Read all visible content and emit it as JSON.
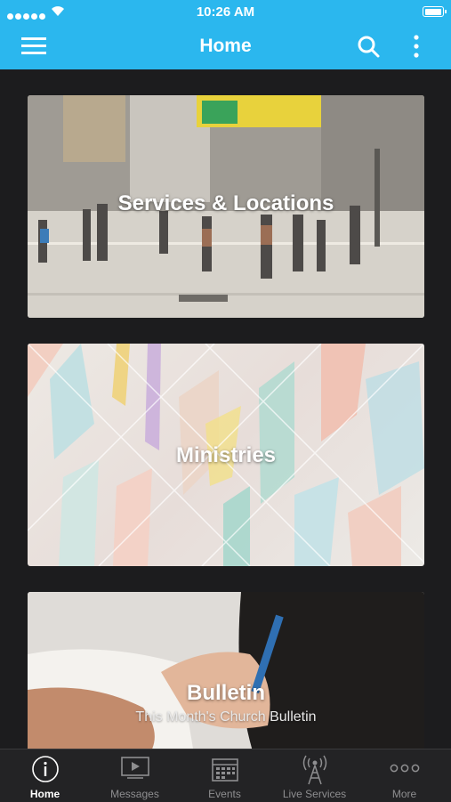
{
  "status_bar": {
    "time": "10:26 AM"
  },
  "header": {
    "title": "Home"
  },
  "cards": [
    {
      "title": "Services & Locations"
    },
    {
      "title": "Ministries"
    },
    {
      "title": "Bulletin",
      "subtitle": "This Month's Church Bulletin"
    }
  ],
  "tabs": [
    {
      "label": "Home",
      "icon": "info-icon",
      "active": true
    },
    {
      "label": "Messages",
      "icon": "video-icon"
    },
    {
      "label": "Events",
      "icon": "calendar-icon"
    },
    {
      "label": "Live Services",
      "icon": "antenna-icon"
    },
    {
      "label": "More",
      "icon": "more-horizontal-icon"
    }
  ],
  "colors": {
    "accent": "#2bb7ee",
    "background": "#1c1c1e",
    "tab_bar": "#232325"
  }
}
